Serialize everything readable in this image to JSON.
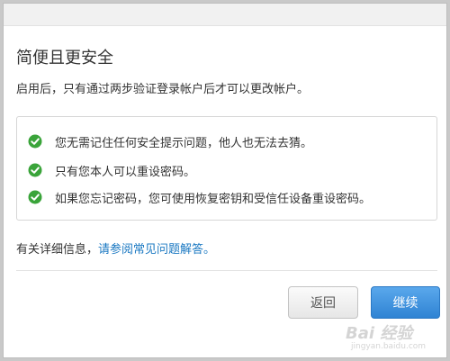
{
  "dialog": {
    "title": "简便且更安全",
    "description": "启用后，只有通过两步验证登录帐户后才可以更改帐户。",
    "features": [
      "您无需记住任何安全提示问题，他人也无法去猜。",
      "只有您本人可以重设密码。",
      "如果您忘记密码，您可使用恢复密钥和受信任设备重设密码。"
    ],
    "info_prefix": "有关详细信息，",
    "info_link": "请参阅常见问题解答。",
    "back_label": "返回",
    "continue_label": "继续"
  },
  "watermark": {
    "logo": "Bai 经验",
    "url": "jingyan.baidu.com"
  },
  "colors": {
    "accent": "#2f83d3",
    "link": "#1a78c2",
    "check": "#3aa43a"
  },
  "icons": {
    "check": "check-circle-icon"
  }
}
